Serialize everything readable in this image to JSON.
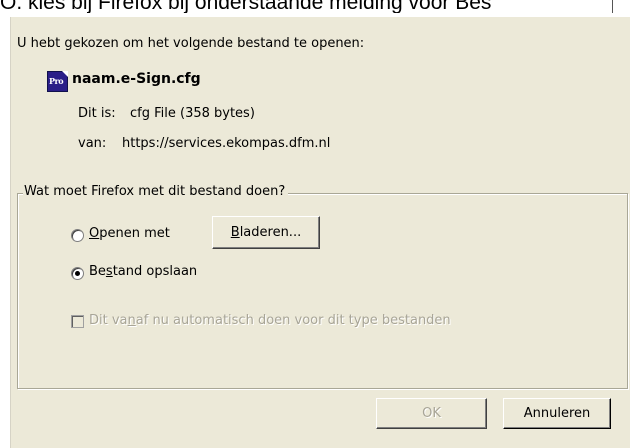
{
  "background_caption": "O. kies bij Firefox bij onderstaande melding voor Bes",
  "dialog": {
    "intro": "U hebt gekozen om het volgende bestand te openen:",
    "file": {
      "name": "naam.e-Sign.cfg",
      "type_label": "Dit is:",
      "type_value": "cfg File (358 bytes)",
      "source_label": "van:",
      "source_value": "https://services.ekompas.dfm.nl",
      "icon": "app-file-icon"
    },
    "group": {
      "legend": "Wat moet Firefox met dit bestand doen?",
      "open_with": {
        "pre": "",
        "accel": "O",
        "post": "penen met",
        "selected": false
      },
      "browse_button": {
        "pre": "",
        "accel": "B",
        "post": "laderen..."
      },
      "save_file": {
        "pre": "Be",
        "accel": "s",
        "post": "tand opslaan",
        "selected": true
      },
      "auto_checkbox": {
        "pre": "Dit va",
        "accel": "n",
        "post": "af nu automatisch doen voor dit type bestanden",
        "checked": false,
        "enabled": false
      }
    },
    "buttons": {
      "ok": "OK",
      "cancel": "Annuleren"
    }
  }
}
